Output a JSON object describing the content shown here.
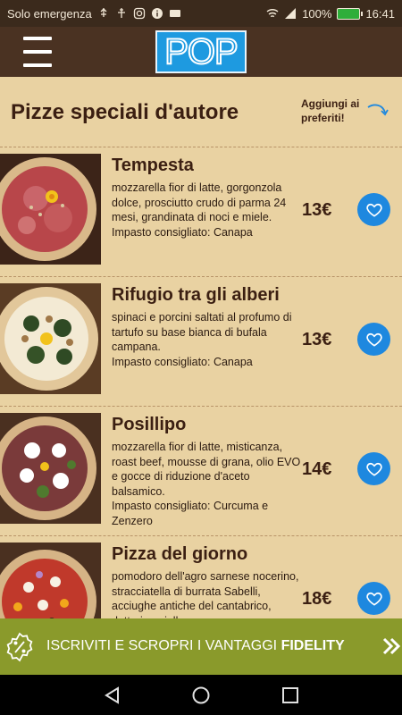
{
  "status_bar": {
    "carrier": "Solo emergenza",
    "battery": "100%",
    "time": "16:41"
  },
  "header": {
    "logo_text": "POP",
    "menu_icon": "hamburger-menu-icon"
  },
  "section": {
    "title": "Pizze speciali d'autore",
    "favorites_hint": "Aggiungi ai preferiti!"
  },
  "items": [
    {
      "name": "Tempesta",
      "description": "mozzarella fior di latte, gorgonzola dolce, prosciutto crudo di parma 24 mesi, grandinata di noci e miele.",
      "dough": "Impasto consigliato: Canapa",
      "price": "13€"
    },
    {
      "name": "Rifugio tra gli alberi",
      "description": "spinaci e porcini saltati al profumo di tartufo su base bianca di bufala campana.",
      "dough": "Impasto consigliato: Canapa",
      "price": "13€"
    },
    {
      "name": "Posillipo",
      "description": "mozzarella fior di latte, misticanza, roast beef, mousse di grana, olio EVO e gocce di riduzione d'aceto balsamico.",
      "dough": "Impasto consigliato: Curcuma e Zenzero",
      "price": "14€"
    },
    {
      "name": "Pizza del giorno",
      "description": "pomodoro dell'agro sarnese nocerino, stracciatella di burrata Sabelli, acciughe antiche del cantabrico, datterino giallo e",
      "dough": "",
      "price": "18€"
    }
  ],
  "promo": {
    "text": "ISCRIVITI E SCROPRI I VANTAGGI",
    "highlight": "FIDELITY"
  },
  "colors": {
    "background": "#e9d2a2",
    "header": "#4a3222",
    "accent": "#1e88df",
    "promo": "#8a9a2b"
  }
}
